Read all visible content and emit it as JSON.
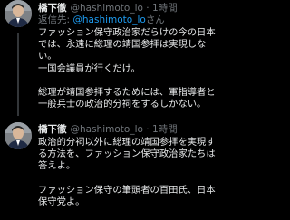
{
  "tweets": [
    {
      "author_name": "橋下徹",
      "handle": "@hashimoto_lo",
      "separator": "·",
      "time": "1時間",
      "reply_prefix": "返信先:",
      "reply_to": "@hashimoto_lo",
      "reply_suffix": "さん",
      "text": "ファッション保守政治家だらけの今の日本では、永遠に総理の靖国参拝は実現しない。\n一国会議員が行くだけ。\n\n総理が靖国参拝するためには、軍指導者と一般兵士の政治的分祠をするしかない。"
    },
    {
      "author_name": "橋下徹",
      "handle": "@hashimoto_lo",
      "separator": "·",
      "time": "1時間",
      "text": "政治的分祠以外に総理の靖国参拝を実現する方法を、ファッション保守政治家たちは答えよ。\n\nファッション保守の筆頭者の百田氏、日本保守党よ。"
    }
  ],
  "icons": [
    "avatar-photo"
  ],
  "colors": {
    "background": "#000000",
    "text_primary": "#e7e9ea",
    "text_secondary": "#71767b",
    "link": "#1d9bf0"
  }
}
